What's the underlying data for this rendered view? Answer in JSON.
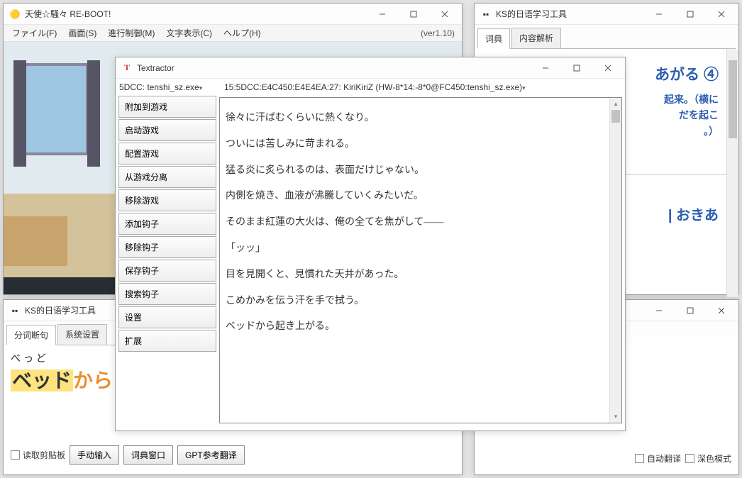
{
  "game_window": {
    "title": "天使☆騒々 RE-BOOT!",
    "menu": {
      "file": "ファイル(F)",
      "screen": "画面(S)",
      "progress": "進行制御(M)",
      "text": "文字表示(C)",
      "help": "ヘルプ(H)",
      "version": "(ver1.10)"
    },
    "watermark": "天使☆騒々\nRE-BOOT!"
  },
  "jp_tool": {
    "title": "KS的日语学习工具",
    "tabs": {
      "dict": "词典",
      "parse": "内容解析"
    },
    "entry_title": "あがる ④",
    "meaning1": "起来。",
    "meaning2": "（横に",
    "meaning3": "だを起こ",
    "meaning4": "。）",
    "alt": "| おきあ"
  },
  "textractor": {
    "title": "Textractor",
    "process_select": "5DCC: tenshi_sz.exe",
    "hook_select": "15:5DCC:E4C450:E4E4EA:27: KiriKiriZ (HW-8*14:-8*0@FC450:tenshi_sz.exe)",
    "buttons": {
      "attach": "附加到游戏",
      "launch": "启动游戏",
      "config": "配置游戏",
      "detach": "从游戏分离",
      "removegame": "移除游戏",
      "addhook": "添加钩子",
      "removehook": "移除钩子",
      "savehook": "保存钩子",
      "searchhook": "搜索钩子",
      "settings": "设置",
      "extensions": "扩展"
    },
    "lines": [
      "徐々に汗ばむくらいに熱くなり。",
      "ついには苦しみに苛まれる。",
      "猛る炎に炙られるのは、表面だけじゃない。",
      "内側を焼き、血液が沸騰していくみたいだ。",
      "そのまま紅蓮の大火は、俺の全てを焦がして——",
      "「ッッ」",
      "目を見開くと、見慣れた天井があった。",
      "こめかみを伝う汗を手で拭う。",
      "ベッドから起き上がる。"
    ]
  },
  "ks_left": {
    "title": "KS的日语学习工具",
    "tabs": {
      "seg": "分词断句",
      "sys": "系统设置"
    },
    "furigana": "べっど",
    "word_hl": "ベッド",
    "word_rest": "から",
    "bottom": {
      "clipboard": "读取剪贴板",
      "manual": "手动输入",
      "dictwin": "词典窗口",
      "gpt": "GPT参考翻译"
    }
  },
  "ks_right": {
    "bottom": {
      "auto": "自动翻译",
      "dark": "深色模式"
    }
  }
}
